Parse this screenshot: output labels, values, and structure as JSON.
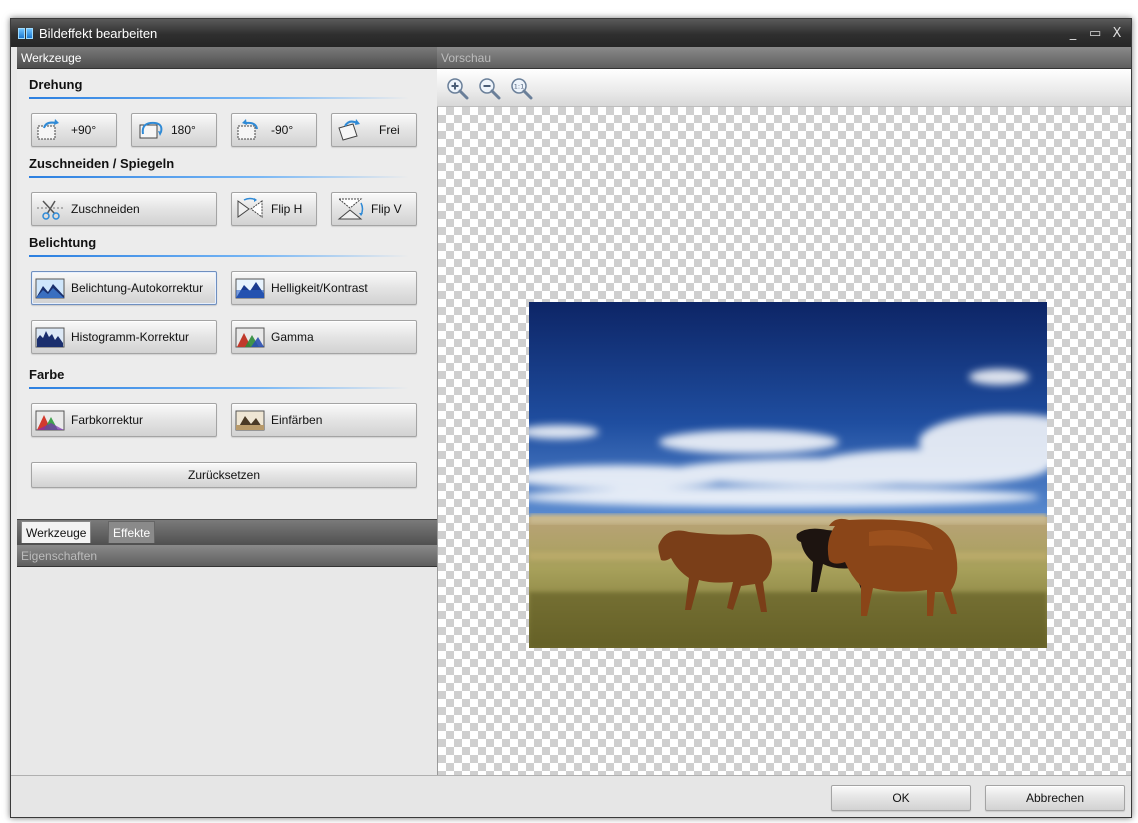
{
  "window": {
    "title": "Bildeffekt bearbeiten",
    "controls": [
      "_",
      "▭",
      "X"
    ]
  },
  "tools_panel": {
    "header": "Werkzeuge",
    "sections": {
      "rotation": {
        "title": "Drehung",
        "buttons": [
          "+90°",
          "180°",
          "-90°",
          "Frei"
        ]
      },
      "crop_mirror": {
        "title": "Zuschneiden / Spiegeln",
        "buttons": [
          "Zuschneiden",
          "Flip H",
          "Flip V"
        ]
      },
      "exposure": {
        "title": "Belichtung",
        "buttons": [
          "Belichtung-Autokorrektur",
          "Helligkeit/Kontrast",
          "Histogramm-Korrektur",
          "Gamma"
        ]
      },
      "color": {
        "title": "Farbe",
        "buttons": [
          "Farbkorrektur",
          "Einfärben"
        ]
      }
    },
    "reset_label": "Zurücksetzen",
    "tabs": [
      "Werkzeuge",
      "Effekte"
    ]
  },
  "properties_panel": {
    "header": "Eigenschaften"
  },
  "preview_panel": {
    "header": "Vorschau",
    "zoom_icons": [
      "zoom-in-icon",
      "zoom-out-icon",
      "zoom-actual-size-icon"
    ],
    "zoom_actual_label": "1:1"
  },
  "footer": {
    "ok_label": "OK",
    "cancel_label": "Abbrechen"
  },
  "colors": {
    "accent_line": "#2b7fe0",
    "titlebar": "#2f2f2f",
    "panel_header": "#5e5e5e"
  }
}
